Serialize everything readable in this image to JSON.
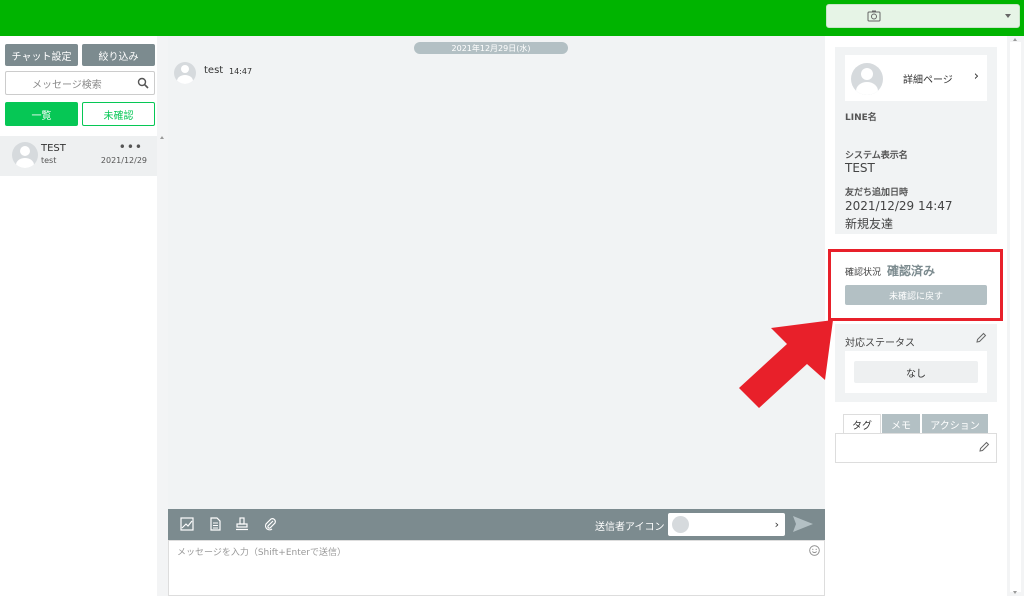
{
  "colors": {
    "brand_green": "#00b400",
    "line_green": "#06c755",
    "gray_button": "#7c8b8f",
    "highlight_red": "#e8202a"
  },
  "topbar": {
    "account_icon": "camera-icon",
    "dropdown_icon": "caret-down-icon"
  },
  "left": {
    "chat_settings_label": "チャット設定",
    "filter_label": "絞り込み",
    "search_placeholder": "メッセージ検索",
    "tab_all": "一覧",
    "tab_unread": "未確認",
    "users": [
      {
        "name": "TEST",
        "sub": "test",
        "date": "2021/12/29",
        "menu": "•••"
      }
    ]
  },
  "chat": {
    "date": "2021年12月29日(水)",
    "messages": [
      {
        "sender": "test",
        "time": "14:47"
      }
    ],
    "sender_icon_label": "送信者アイコン",
    "input_placeholder": "メッセージを入力（Shift+Enterで送信）"
  },
  "profile": {
    "detail_page": "詳細ページ",
    "line_name_label": "LINE名",
    "system_name_label": "システム表示名",
    "system_name": "TEST",
    "added_label": "友だち追加日時",
    "added_value": "2021/12/29 14:47",
    "friend_type": "新規友達"
  },
  "confirm": {
    "status_label": "確認状況",
    "status_value": "確認済み",
    "revert_button": "未確認に戻す"
  },
  "response": {
    "title": "対応ステータス",
    "value": "なし"
  },
  "tabs": [
    "タグ",
    "メモ",
    "アクション"
  ]
}
